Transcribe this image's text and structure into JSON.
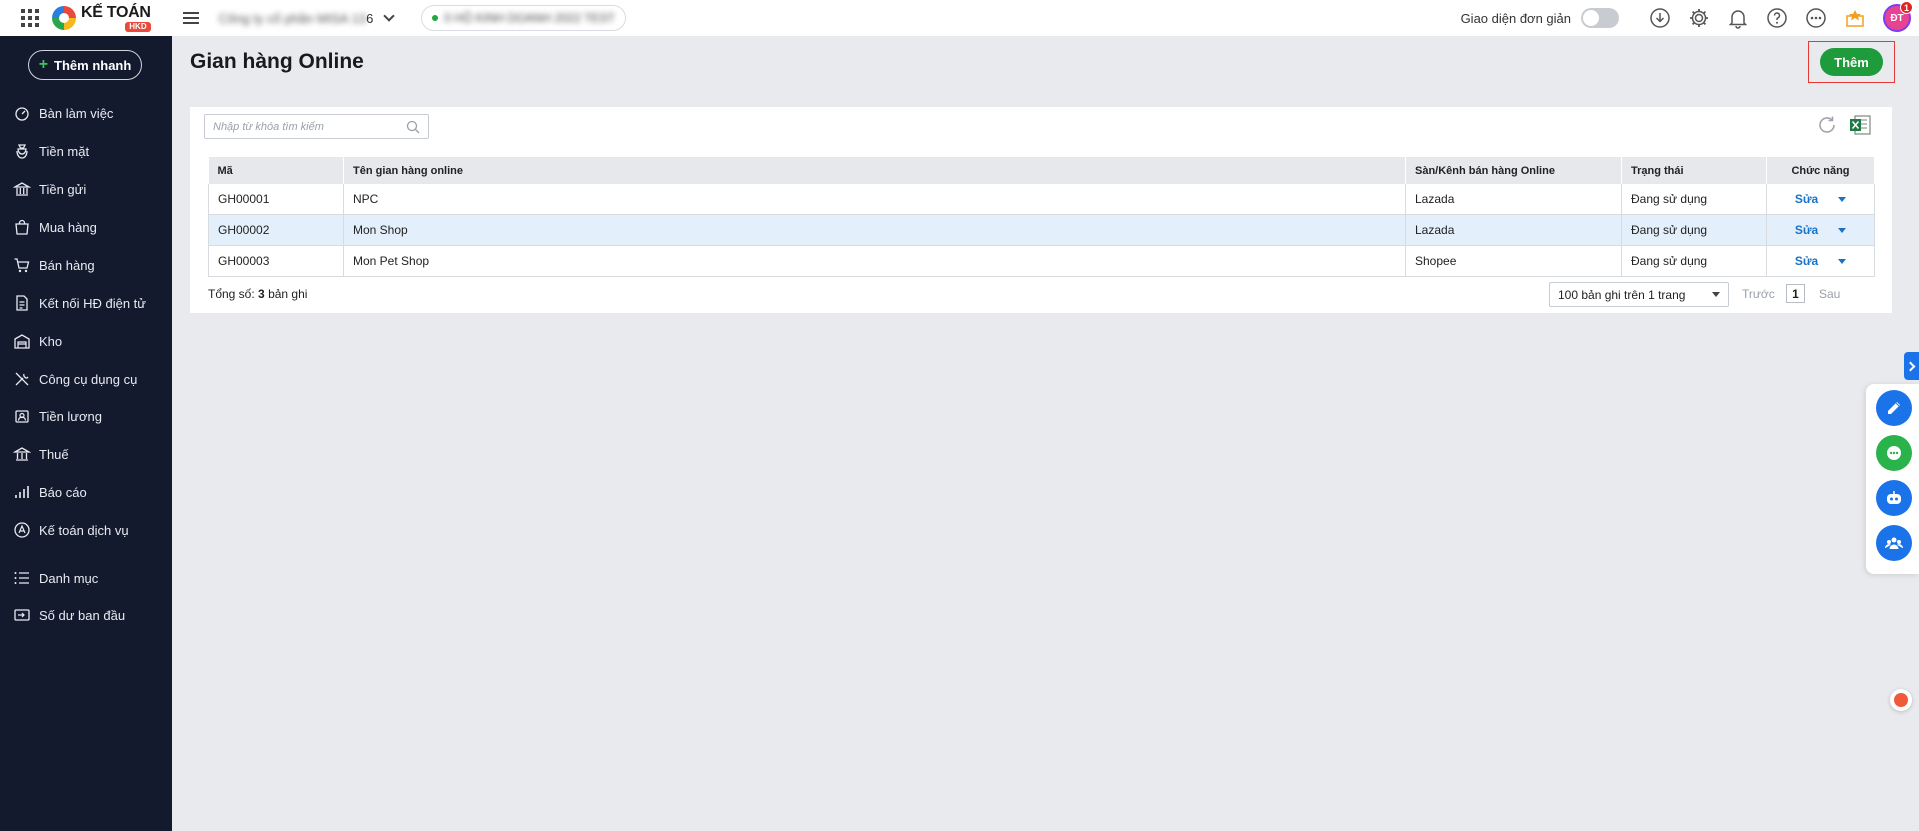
{
  "topbar": {
    "logo_name": "KẾ TOÁN",
    "logo_sub": "HKD",
    "company_name_blurred": "Công ty cổ phần MISA 13",
    "company_name_suffix": "6",
    "tax_blurred": "0 HỘ KINH DOANH 2022 TEST",
    "simple_ui_label": "Giao diện đơn giản",
    "simple_ui_enabled": false,
    "avatar_initials": "ĐT",
    "avatar_badge": "1"
  },
  "sidebar": {
    "quick_add": "Thêm nhanh",
    "items": [
      {
        "label": "Bàn làm việc",
        "icon": "desk-icon"
      },
      {
        "label": "Tiền mặt",
        "icon": "cash-bag-icon"
      },
      {
        "label": "Tiền gửi",
        "icon": "bank-icon"
      },
      {
        "label": "Mua hàng",
        "icon": "shopping-bag-icon"
      },
      {
        "label": "Bán hàng",
        "icon": "cart-icon"
      },
      {
        "label": "Kết nối HĐ điện tử",
        "icon": "invoice-icon"
      },
      {
        "label": "Kho",
        "icon": "warehouse-icon"
      },
      {
        "label": "Công cụ dụng cụ",
        "icon": "tools-icon"
      },
      {
        "label": "Tiền lương",
        "icon": "salary-icon"
      },
      {
        "label": "Thuế",
        "icon": "tax-building-icon"
      },
      {
        "label": "Báo cáo",
        "icon": "report-chart-icon"
      },
      {
        "label": "Kế toán dịch vụ",
        "icon": "accounting-service-icon"
      },
      {
        "label": "Danh mục",
        "icon": "list-icon"
      },
      {
        "label": "Số dư ban đầu",
        "icon": "opening-balance-icon"
      }
    ]
  },
  "main": {
    "title": "Gian hàng Online",
    "add_button": "Thêm",
    "search_placeholder": "Nhập từ khóa tìm kiếm",
    "columns": [
      "Mã",
      "Tên gian hàng online",
      "Sàn/Kênh bán hàng Online",
      "Trạng thái",
      "Chức năng"
    ],
    "rows": [
      {
        "code": "GH00001",
        "name": "NPC",
        "channel": "Lazada",
        "status": "Đang sử dụng",
        "action": "Sửa"
      },
      {
        "code": "GH00002",
        "name": "Mon Shop",
        "channel": "Lazada",
        "status": "Đang sử dụng",
        "action": "Sửa"
      },
      {
        "code": "GH00003",
        "name": "Mon Pet Shop",
        "channel": "Shopee",
        "status": "Đang sử dụng",
        "action": "Sửa"
      }
    ],
    "selected_row": 1,
    "total_prefix": "Tổng số:",
    "total_count": "3",
    "total_suffix": "bản ghi",
    "page_size": "100 bản ghi trên 1 trang",
    "prev": "Trước",
    "page": "1",
    "next": "Sau"
  },
  "colors": {
    "sidebar_bg": "#131a2e",
    "accent_green": "#1e9b3a",
    "link_blue": "#1a73c8",
    "highlight_red": "#e53935"
  }
}
